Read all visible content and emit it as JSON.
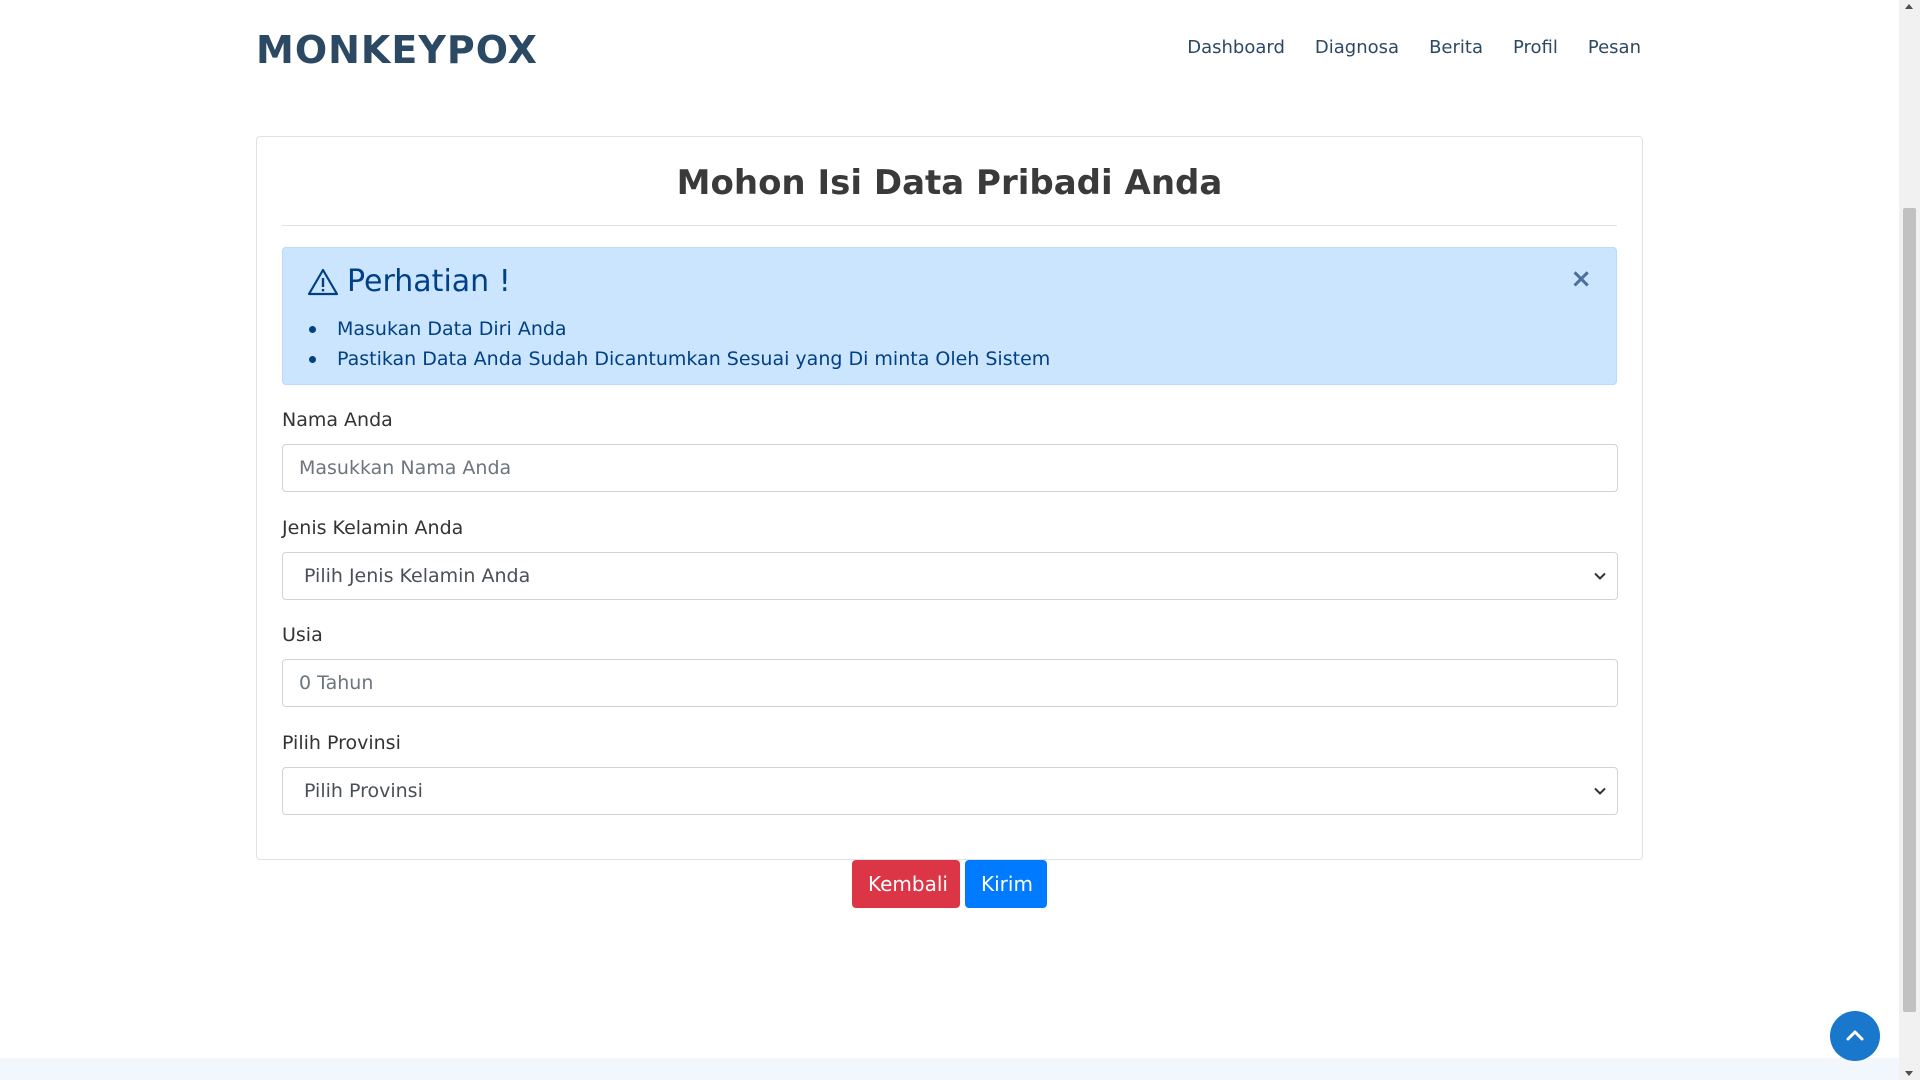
{
  "header": {
    "logo": "MONKEYPOX",
    "nav": [
      "Dashboard",
      "Diagnosa",
      "Berita",
      "Profil",
      "Pesan"
    ]
  },
  "form": {
    "title": "Mohon Isi Data Pribadi Anda",
    "alert": {
      "heading": "Perhatian !",
      "close": "×",
      "items": [
        "Masukan Data Diri Anda",
        "Pastikan Data Anda Sudah Dicantumkan Sesuai yang Di minta Oleh Sistem"
      ]
    },
    "name_label": "Nama Anda",
    "name_placeholder": "Masukkan Nama Anda",
    "gender_label": "Jenis Kelamin Anda",
    "gender_selected": "Pilih Jenis Kelamin Anda",
    "age_label": "Usia",
    "age_placeholder": "0 Tahun",
    "province_label": "Pilih Provinsi",
    "province_selected": "Pilih Provinsi"
  },
  "buttons": {
    "back": "Kembali",
    "submit": "Kirim"
  },
  "colors": {
    "brand": "#2c4964",
    "alert_bg": "#cce5ff",
    "danger": "#dc3545",
    "primary": "#007bff",
    "back_to_top": "#1977cc"
  }
}
